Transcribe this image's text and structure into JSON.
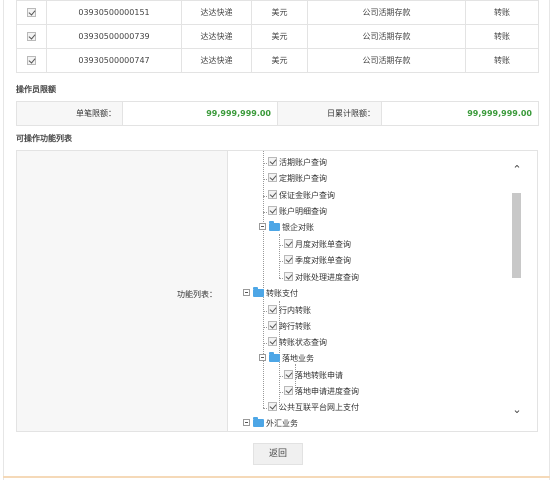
{
  "accounts": [
    {
      "checked": true,
      "number": "03930500000151",
      "bank": "达达快递",
      "currency": "美元",
      "type": "公司活期存款",
      "op": "转账"
    },
    {
      "checked": true,
      "number": "03930500000739",
      "bank": "达达快递",
      "currency": "美元",
      "type": "公司活期存款",
      "op": "转账"
    },
    {
      "checked": true,
      "number": "03930500000747",
      "bank": "达达快递",
      "currency": "美元",
      "type": "公司活期存款",
      "op": "转账"
    }
  ],
  "limits": {
    "title": "操作员限额",
    "single_label": "单笔限额：",
    "single_value": "99,999,999.00",
    "daily_label": "日累计限额：",
    "daily_value": "99,999,999.00"
  },
  "functions": {
    "title": "可操作功能列表",
    "label": "功能列表：",
    "tree": [
      {
        "label": "活期账户查询",
        "kind": "leaf"
      },
      {
        "label": "定期账户查询",
        "kind": "leaf"
      },
      {
        "label": "保证金账户查询",
        "kind": "leaf"
      },
      {
        "label": "账户明细查询",
        "kind": "leaf"
      },
      {
        "label": "银企对账",
        "kind": "folder"
      },
      {
        "label": "月度对账单查询",
        "kind": "leaf"
      },
      {
        "label": "季度对账单查询",
        "kind": "leaf"
      },
      {
        "label": "对账处理进度查询",
        "kind": "leaf"
      },
      {
        "label": "转账支付",
        "kind": "folder"
      },
      {
        "label": "行内转账",
        "kind": "leaf"
      },
      {
        "label": "跨行转账",
        "kind": "leaf"
      },
      {
        "label": "转账状态查询",
        "kind": "leaf"
      },
      {
        "label": "落地业务",
        "kind": "folder"
      },
      {
        "label": "落地转账申请",
        "kind": "leaf"
      },
      {
        "label": "落地申请进度查询",
        "kind": "leaf"
      },
      {
        "label": "公共互联平台网上支付",
        "kind": "leaf"
      },
      {
        "label": "外汇业务",
        "kind": "folder"
      }
    ],
    "scroll_up_icon": "chevron-up-icon",
    "scroll_down_icon": "chevron-down-icon"
  },
  "buttons": {
    "back": "返回"
  },
  "colors": {
    "amount_green": "#3a9a3a",
    "folder_blue": "#4da6e6"
  }
}
